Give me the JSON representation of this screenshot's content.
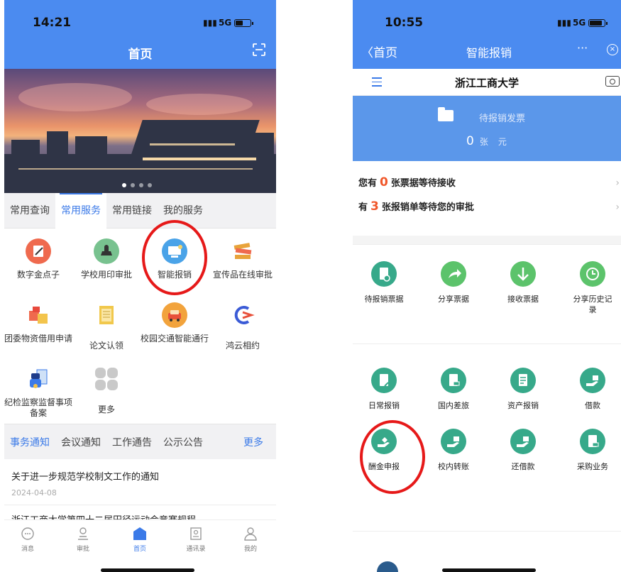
{
  "left": {
    "status_time": "14:21",
    "network": "5G",
    "title": "首页",
    "tabs": [
      "常用查询",
      "常用服务",
      "常用链接",
      "我的服务"
    ],
    "active_tab": 1,
    "services": [
      {
        "label": "数字金点子",
        "icon": "edit-icon",
        "color": "#ef6a4e"
      },
      {
        "label": "学校用印审批",
        "icon": "stamp-icon",
        "color": "#78c28f"
      },
      {
        "label": "智能报销",
        "icon": "computer-icon",
        "color": "#4aa3e8"
      },
      {
        "label": "宣传品在线审批",
        "icon": "books-icon",
        "color": "#e8a33a"
      },
      {
        "label": "团委物资借用申请",
        "icon": "boxes-icon",
        "color": "#ef6a4e"
      },
      {
        "label": "论文认领",
        "icon": "document-icon",
        "color": "#f1c84c"
      },
      {
        "label": "校园交通智能通行",
        "icon": "car-icon",
        "color": "#f2a33c"
      },
      {
        "label": "鸿云相约",
        "icon": "cloud-logo-icon",
        "color": "#3b5bd6"
      },
      {
        "label": "纪检监察监督事项备案",
        "icon": "police-icon",
        "color": "#3b7ae8"
      },
      {
        "label": "更多",
        "icon": "more-grid-icon",
        "color": "#c9c9c9"
      }
    ],
    "news_tabs": [
      "事务通知",
      "会议通知",
      "工作通告",
      "公示公告"
    ],
    "news_more": "更多",
    "news": [
      {
        "title": "关于进一步规范学校制文工作的通知",
        "date": "2024-04-08"
      },
      {
        "title": "浙江工商大学第四十二届田径运动会竞赛规程",
        "date": ""
      }
    ],
    "tabbar": [
      {
        "label": "消息",
        "icon": "chat-icon"
      },
      {
        "label": "审批",
        "icon": "approve-icon"
      },
      {
        "label": "首页",
        "icon": "home-icon"
      },
      {
        "label": "通讯录",
        "icon": "contacts-icon"
      },
      {
        "label": "我的",
        "icon": "user-icon"
      }
    ],
    "active_tabbar": 2
  },
  "right": {
    "status_time": "10:55",
    "network": "5G",
    "back_label": "首页",
    "title": "智能报销",
    "more_label": "···",
    "university": "浙江工商大学",
    "invoice_label": "待报销发票",
    "invoice_count": "0",
    "invoice_unit1": "张",
    "invoice_unit2": "元",
    "pending_receive_prefix": "您有",
    "pending_receive_count": "0",
    "pending_receive_suffix": "张票据等待接收",
    "pending_approve_prefix": "有",
    "pending_approve_count": "3",
    "pending_approve_suffix": "张报销单等待您的审批",
    "row1": [
      {
        "label": "待报销票据",
        "icon": "receipt-pending-icon"
      },
      {
        "label": "分享票据",
        "icon": "share-icon"
      },
      {
        "label": "接收票据",
        "icon": "download-icon"
      },
      {
        "label": "分享历史记录",
        "icon": "history-icon"
      }
    ],
    "row2": [
      {
        "label": "日常报销",
        "icon": "daily-reimburse-icon"
      },
      {
        "label": "国内差旅",
        "icon": "travel-icon"
      },
      {
        "label": "资产报销",
        "icon": "asset-icon"
      },
      {
        "label": "借款",
        "icon": "loan-icon"
      }
    ],
    "row3": [
      {
        "label": "酬金申报",
        "icon": "reward-icon"
      },
      {
        "label": "校内转账",
        "icon": "transfer-icon"
      },
      {
        "label": "还借款",
        "icon": "repay-icon"
      },
      {
        "label": "采购业务",
        "icon": "purchase-icon"
      }
    ]
  },
  "colors": {
    "primary": "#4b8bf0",
    "accent_blue": "#3b7ae8",
    "teal": "#37a98a",
    "green": "#5cc36b",
    "highlight_red": "#e61919",
    "count_orange": "#f0572a"
  }
}
